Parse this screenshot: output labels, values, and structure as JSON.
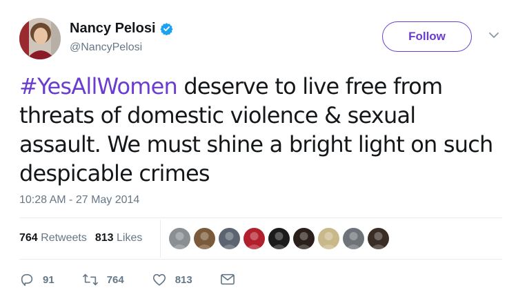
{
  "author": {
    "name": "Nancy Pelosi",
    "handle": "@NancyPelosi",
    "verified": true
  },
  "follow_label": "Follow",
  "tweet": {
    "hashtag": "#YesAllWomen",
    "text": " deserve to live free from threats of domestic violence & sexual assault. We must shine a bright light on such despicable crimes",
    "timestamp": "10:28 AM - 27 May 2014"
  },
  "stats": {
    "retweets_count": "764",
    "retweets_label": "Retweets",
    "likes_count": "813",
    "likes_label": "Likes"
  },
  "likers": [
    {
      "icon": "landscape-avatar",
      "color": "#8a8f93"
    },
    {
      "icon": "man-avatar",
      "color": "#7a5a3a"
    },
    {
      "icon": "man-sunglasses-avatar",
      "color": "#5b6470"
    },
    {
      "icon": "flag-emblem-avatar",
      "color": "#b21f2d"
    },
    {
      "icon": "dark-emblem-avatar",
      "color": "#1b1b1b"
    },
    {
      "icon": "woman-avatar",
      "color": "#2a1f1a"
    },
    {
      "icon": "handshake-avatar",
      "color": "#c9b98a"
    },
    {
      "icon": "grey-landscape-avatar",
      "color": "#6d7378"
    },
    {
      "icon": "man-suit-avatar",
      "color": "#3a2d26"
    }
  ],
  "actions": {
    "reply_count": "91",
    "retweet_count": "764",
    "like_count": "813"
  },
  "colors": {
    "accent": "#6a3cd0",
    "muted": "#657786",
    "verified": "#1da1f2"
  }
}
